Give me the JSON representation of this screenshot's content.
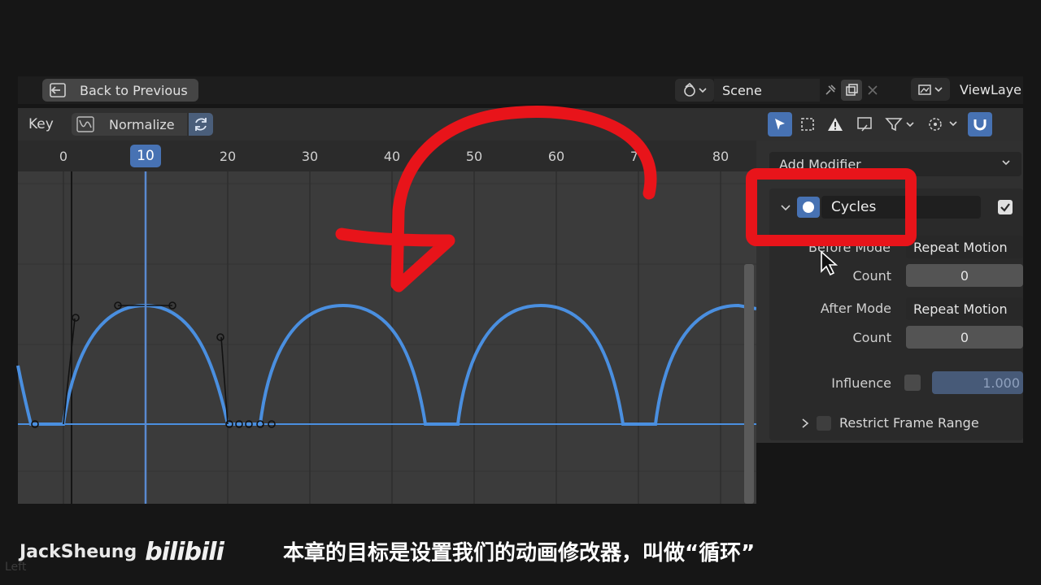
{
  "topbar": {
    "back_label": "Back to Previous",
    "scene": "Scene",
    "view_layer": "ViewLaye"
  },
  "header": {
    "key_label": "Key",
    "normalize_label": "Normalize"
  },
  "timeline": {
    "ticks": [
      "0",
      "10",
      "20",
      "30",
      "40",
      "50",
      "60",
      "7",
      "80"
    ],
    "current_frame": "10"
  },
  "panel": {
    "add_modifier": "Add Modifier",
    "modifier_name": "Cycles",
    "modifier_enabled": true,
    "before_mode_label": "Before Mode",
    "before_mode_value": "Repeat Motion",
    "before_count_label": "Count",
    "before_count_value": "0",
    "after_mode_label": "After Mode",
    "after_mode_value": "Repeat Motion",
    "after_count_label": "Count",
    "after_count_value": "0",
    "influence_label": "Influence",
    "influence_value": "1.000",
    "restrict_label": "Restrict Frame Range"
  },
  "overlay": {
    "watermark_name": "JackSheung",
    "watermark_logo": "bilibili",
    "subtitle": "本章的目标是设置我们的动画修改器，叫做“循环”",
    "corner_text": "Left"
  },
  "colors": {
    "accent": "#4772b3",
    "curve": "#4a8fe0",
    "annotation": "#e8141a"
  }
}
